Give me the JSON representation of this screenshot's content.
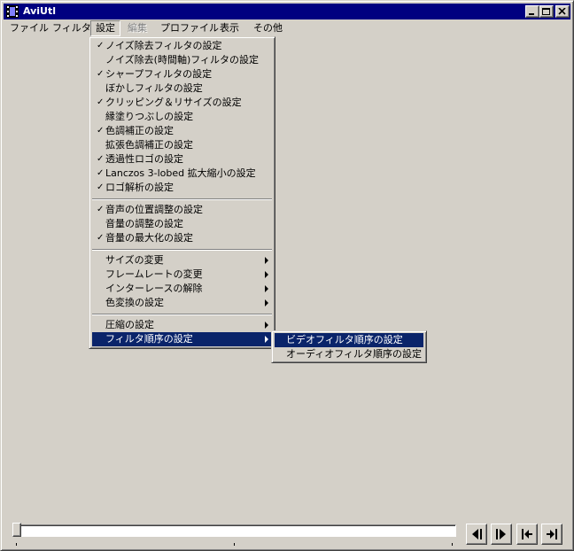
{
  "window": {
    "title": "AviUtl",
    "icon": "film-strip-icon",
    "controls": [
      "minimize-icon",
      "maximize-icon",
      "close-icon"
    ]
  },
  "menubar": [
    {
      "label": "ファイル",
      "state": "normal"
    },
    {
      "label": "フィルタ",
      "state": "normal"
    },
    {
      "label": "設定",
      "state": "active"
    },
    {
      "label": "編集",
      "state": "disabled"
    },
    {
      "label": "プロファイル",
      "state": "normal"
    },
    {
      "label": "表示",
      "state": "normal"
    },
    {
      "label": "その他",
      "state": "normal"
    }
  ],
  "settings_menu": {
    "groups": [
      [
        {
          "label": "ノイズ除去フィルタの設定",
          "checked": true
        },
        {
          "label": "ノイズ除去(時間軸)フィルタの設定",
          "checked": false
        },
        {
          "label": "シャープフィルタの設定",
          "checked": true
        },
        {
          "label": "ぼかしフィルタの設定",
          "checked": false
        },
        {
          "label": "クリッピング＆リサイズの設定",
          "checked": true
        },
        {
          "label": "縁塗りつぶしの設定",
          "checked": false
        },
        {
          "label": "色調補正の設定",
          "checked": true
        },
        {
          "label": "拡張色調補正の設定",
          "checked": false
        },
        {
          "label": "透過性ロゴの設定",
          "checked": true
        },
        {
          "label": "Lanczos 3-lobed 拡大縮小の設定",
          "checked": true
        },
        {
          "label": "ロゴ解析の設定",
          "checked": true
        }
      ],
      [
        {
          "label": "音声の位置調整の設定",
          "checked": true
        },
        {
          "label": "音量の調整の設定",
          "checked": false
        },
        {
          "label": "音量の最大化の設定",
          "checked": true
        }
      ],
      [
        {
          "label": "サイズの変更",
          "submenu": true
        },
        {
          "label": "フレームレートの変更",
          "submenu": true
        },
        {
          "label": "インターレースの解除",
          "submenu": true
        },
        {
          "label": "色変換の設定",
          "submenu": true
        }
      ],
      [
        {
          "label": "圧縮の設定",
          "submenu": true
        },
        {
          "label": "フィルタ順序の設定",
          "submenu": true,
          "highlighted": true
        }
      ]
    ],
    "check_glyph": "✓"
  },
  "filter_order_submenu": [
    {
      "label": "ビデオフィルタ順序の設定",
      "highlighted": true
    },
    {
      "label": "オーディオフィルタ順序の設定",
      "highlighted": false
    }
  ],
  "seekbar": {
    "position": 0
  },
  "nav_buttons": [
    "prev-frame-icon",
    "next-frame-icon",
    "jump-start-icon",
    "jump-end-icon"
  ],
  "colors": {
    "title_bg": "#000080",
    "face": "#d4d0c8",
    "highlight": "#0a246a",
    "disabled_text": "#808080"
  }
}
